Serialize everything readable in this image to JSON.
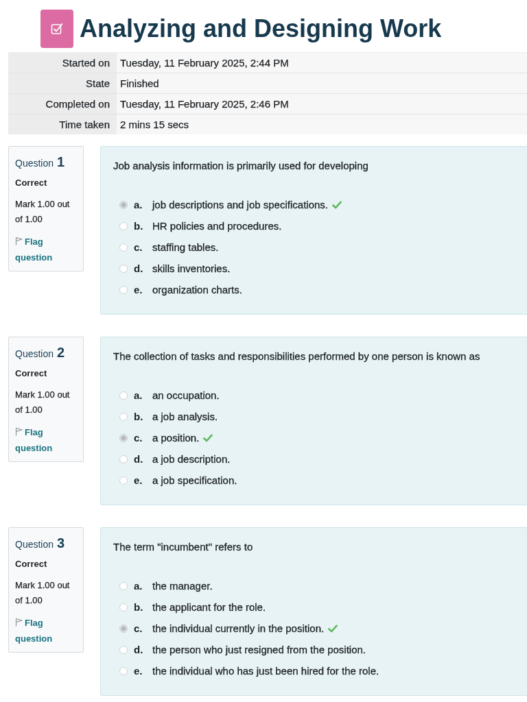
{
  "header": {
    "title": "Analyzing and Designing Work"
  },
  "summary": [
    {
      "label": "Started on",
      "value": "Tuesday, 11 February 2025, 2:44 PM"
    },
    {
      "label": "State",
      "value": "Finished"
    },
    {
      "label": "Completed on",
      "value": "Tuesday, 11 February 2025, 2:46 PM"
    },
    {
      "label": "Time taken",
      "value": "2 mins 15 secs"
    }
  ],
  "questions": [
    {
      "label": "Question",
      "number": "1",
      "status": "Correct",
      "mark": "Mark 1.00 out of 1.00",
      "flag": "Flag question",
      "text": "Job analysis information is primarily used for developing",
      "options": [
        {
          "letter": "a.",
          "text": "job descriptions and job specifications.",
          "selected": true,
          "correct": true
        },
        {
          "letter": "b.",
          "text": "HR policies and procedures.",
          "selected": false,
          "correct": false
        },
        {
          "letter": "c.",
          "text": "staffing tables.",
          "selected": false,
          "correct": false
        },
        {
          "letter": "d.",
          "text": "skills inventories.",
          "selected": false,
          "correct": false
        },
        {
          "letter": "e.",
          "text": "organization charts.",
          "selected": false,
          "correct": false
        }
      ]
    },
    {
      "label": "Question",
      "number": "2",
      "status": "Correct",
      "mark": "Mark 1.00 out of 1.00",
      "flag": "Flag question",
      "text": "The collection of tasks and responsibilities performed by one person is known as",
      "options": [
        {
          "letter": "a.",
          "text": "an occupation.",
          "selected": false,
          "correct": false
        },
        {
          "letter": "b.",
          "text": "a job analysis.",
          "selected": false,
          "correct": false
        },
        {
          "letter": "c.",
          "text": "a position.",
          "selected": true,
          "correct": true
        },
        {
          "letter": "d.",
          "text": "a job description.",
          "selected": false,
          "correct": false
        },
        {
          "letter": "e.",
          "text": "a job specification.",
          "selected": false,
          "correct": false
        }
      ]
    },
    {
      "label": "Question",
      "number": "3",
      "status": "Correct",
      "mark": "Mark 1.00 out of 1.00",
      "flag": "Flag question",
      "text": "The term \"incumbent\" refers to",
      "options": [
        {
          "letter": "a.",
          "text": "the manager.",
          "selected": false,
          "correct": false
        },
        {
          "letter": "b.",
          "text": "the applicant for the role.",
          "selected": false,
          "correct": false
        },
        {
          "letter": "c.",
          "text": "the individual currently in the position.",
          "selected": true,
          "correct": true
        },
        {
          "letter": "d.",
          "text": "the person who just resigned from the position.",
          "selected": false,
          "correct": false
        },
        {
          "letter": "e.",
          "text": "the individual who has just been hired for the role.",
          "selected": false,
          "correct": false
        }
      ]
    }
  ]
}
